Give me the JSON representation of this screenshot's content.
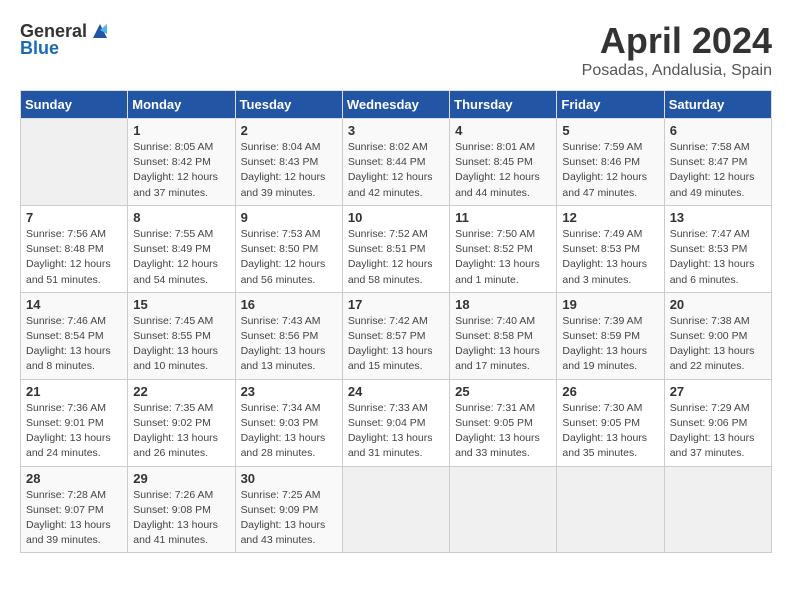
{
  "header": {
    "logo_general": "General",
    "logo_blue": "Blue",
    "title": "April 2024",
    "subtitle": "Posadas, Andalusia, Spain"
  },
  "days_of_week": [
    "Sunday",
    "Monday",
    "Tuesday",
    "Wednesday",
    "Thursday",
    "Friday",
    "Saturday"
  ],
  "weeks": [
    [
      {
        "day": "",
        "info": ""
      },
      {
        "day": "1",
        "info": "Sunrise: 8:05 AM\nSunset: 8:42 PM\nDaylight: 12 hours\nand 37 minutes."
      },
      {
        "day": "2",
        "info": "Sunrise: 8:04 AM\nSunset: 8:43 PM\nDaylight: 12 hours\nand 39 minutes."
      },
      {
        "day": "3",
        "info": "Sunrise: 8:02 AM\nSunset: 8:44 PM\nDaylight: 12 hours\nand 42 minutes."
      },
      {
        "day": "4",
        "info": "Sunrise: 8:01 AM\nSunset: 8:45 PM\nDaylight: 12 hours\nand 44 minutes."
      },
      {
        "day": "5",
        "info": "Sunrise: 7:59 AM\nSunset: 8:46 PM\nDaylight: 12 hours\nand 47 minutes."
      },
      {
        "day": "6",
        "info": "Sunrise: 7:58 AM\nSunset: 8:47 PM\nDaylight: 12 hours\nand 49 minutes."
      }
    ],
    [
      {
        "day": "7",
        "info": "Sunrise: 7:56 AM\nSunset: 8:48 PM\nDaylight: 12 hours\nand 51 minutes."
      },
      {
        "day": "8",
        "info": "Sunrise: 7:55 AM\nSunset: 8:49 PM\nDaylight: 12 hours\nand 54 minutes."
      },
      {
        "day": "9",
        "info": "Sunrise: 7:53 AM\nSunset: 8:50 PM\nDaylight: 12 hours\nand 56 minutes."
      },
      {
        "day": "10",
        "info": "Sunrise: 7:52 AM\nSunset: 8:51 PM\nDaylight: 12 hours\nand 58 minutes."
      },
      {
        "day": "11",
        "info": "Sunrise: 7:50 AM\nSunset: 8:52 PM\nDaylight: 13 hours\nand 1 minute."
      },
      {
        "day": "12",
        "info": "Sunrise: 7:49 AM\nSunset: 8:53 PM\nDaylight: 13 hours\nand 3 minutes."
      },
      {
        "day": "13",
        "info": "Sunrise: 7:47 AM\nSunset: 8:53 PM\nDaylight: 13 hours\nand 6 minutes."
      }
    ],
    [
      {
        "day": "14",
        "info": "Sunrise: 7:46 AM\nSunset: 8:54 PM\nDaylight: 13 hours\nand 8 minutes."
      },
      {
        "day": "15",
        "info": "Sunrise: 7:45 AM\nSunset: 8:55 PM\nDaylight: 13 hours\nand 10 minutes."
      },
      {
        "day": "16",
        "info": "Sunrise: 7:43 AM\nSunset: 8:56 PM\nDaylight: 13 hours\nand 13 minutes."
      },
      {
        "day": "17",
        "info": "Sunrise: 7:42 AM\nSunset: 8:57 PM\nDaylight: 13 hours\nand 15 minutes."
      },
      {
        "day": "18",
        "info": "Sunrise: 7:40 AM\nSunset: 8:58 PM\nDaylight: 13 hours\nand 17 minutes."
      },
      {
        "day": "19",
        "info": "Sunrise: 7:39 AM\nSunset: 8:59 PM\nDaylight: 13 hours\nand 19 minutes."
      },
      {
        "day": "20",
        "info": "Sunrise: 7:38 AM\nSunset: 9:00 PM\nDaylight: 13 hours\nand 22 minutes."
      }
    ],
    [
      {
        "day": "21",
        "info": "Sunrise: 7:36 AM\nSunset: 9:01 PM\nDaylight: 13 hours\nand 24 minutes."
      },
      {
        "day": "22",
        "info": "Sunrise: 7:35 AM\nSunset: 9:02 PM\nDaylight: 13 hours\nand 26 minutes."
      },
      {
        "day": "23",
        "info": "Sunrise: 7:34 AM\nSunset: 9:03 PM\nDaylight: 13 hours\nand 28 minutes."
      },
      {
        "day": "24",
        "info": "Sunrise: 7:33 AM\nSunset: 9:04 PM\nDaylight: 13 hours\nand 31 minutes."
      },
      {
        "day": "25",
        "info": "Sunrise: 7:31 AM\nSunset: 9:05 PM\nDaylight: 13 hours\nand 33 minutes."
      },
      {
        "day": "26",
        "info": "Sunrise: 7:30 AM\nSunset: 9:05 PM\nDaylight: 13 hours\nand 35 minutes."
      },
      {
        "day": "27",
        "info": "Sunrise: 7:29 AM\nSunset: 9:06 PM\nDaylight: 13 hours\nand 37 minutes."
      }
    ],
    [
      {
        "day": "28",
        "info": "Sunrise: 7:28 AM\nSunset: 9:07 PM\nDaylight: 13 hours\nand 39 minutes."
      },
      {
        "day": "29",
        "info": "Sunrise: 7:26 AM\nSunset: 9:08 PM\nDaylight: 13 hours\nand 41 minutes."
      },
      {
        "day": "30",
        "info": "Sunrise: 7:25 AM\nSunset: 9:09 PM\nDaylight: 13 hours\nand 43 minutes."
      },
      {
        "day": "",
        "info": ""
      },
      {
        "day": "",
        "info": ""
      },
      {
        "day": "",
        "info": ""
      },
      {
        "day": "",
        "info": ""
      }
    ]
  ]
}
